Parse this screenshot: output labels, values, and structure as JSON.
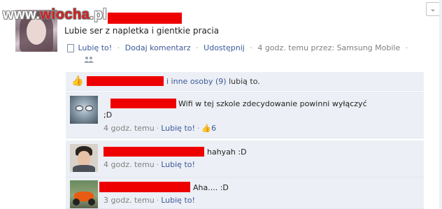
{
  "watermark": {
    "prefix": "www.",
    "brand": "wiocha",
    "suffix": ".pl"
  },
  "post": {
    "text": "Lubie ser z naplетka i gientkie pracia",
    "actions": {
      "like": "Lubię to!",
      "comment": "Dodaj komentarz",
      "share": "Udostępnij",
      "time_via": "4 godz. temu przez: Samsung Mobile"
    }
  },
  "likes": {
    "others": "i inne osoby (9)",
    "suffix": " lubią to."
  },
  "comments": [
    {
      "line1": "Wifi w tej szkole zdecydowanie powinni wyłączyć",
      "line2": ";D",
      "time": "4 godz. temu",
      "like": "Lubię to!",
      "like_count": "6"
    },
    {
      "line1": "hahyah :D",
      "time": "4 godz. temu",
      "like": "Lubię to!"
    },
    {
      "line1": "Aha.... :D",
      "time": "3 godz. temu",
      "like": "Lubię to!"
    }
  ],
  "icons": {
    "corner": "chevron-down-icon",
    "mobile": "phone-icon",
    "people": "people-icon",
    "like": "thumbs-up-icon"
  },
  "colors": {
    "link": "#3b5998",
    "redaction": "#ee0000",
    "comment_bg": "#eceff5",
    "meta": "#808080"
  }
}
